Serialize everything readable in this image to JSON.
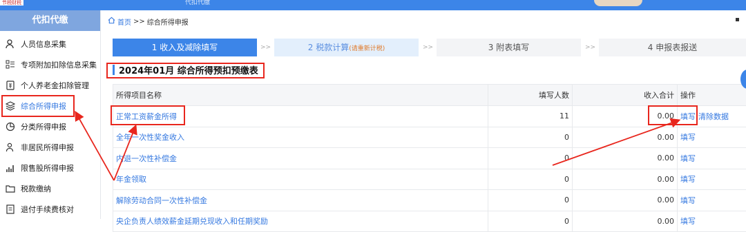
{
  "topbar": {
    "logo_text": "节税财税",
    "title": "代扣代缴"
  },
  "sidebar": {
    "header": "代扣代缴",
    "items": [
      {
        "label": "人员信息采集",
        "icon": "person-icon"
      },
      {
        "label": "专项附加扣除信息采集",
        "icon": "list-icon"
      },
      {
        "label": "个人养老金扣除管理",
        "icon": "pension-icon"
      },
      {
        "label": "综合所得申报",
        "icon": "layers-icon",
        "active": true
      },
      {
        "label": "分类所得申报",
        "icon": "pie-icon"
      },
      {
        "label": "非居民所得申报",
        "icon": "user-icon"
      },
      {
        "label": "限售股所得申报",
        "icon": "bar-chart-icon"
      },
      {
        "label": "税款缴纳",
        "icon": "folder-icon"
      },
      {
        "label": "退付手续费核对",
        "icon": "document-icon"
      }
    ]
  },
  "breadcrumb": {
    "home": "首页",
    "separator": ">>",
    "current": "综合所得申报"
  },
  "steps": [
    {
      "label": "1 收入及减除填写",
      "state": "active"
    },
    {
      "label": "2 税款计算",
      "note": "(请重新计税)",
      "state": "light"
    },
    {
      "label": "3 附表填写",
      "state": "normal"
    },
    {
      "label": "4 申报表报送",
      "state": "normal"
    }
  ],
  "step_arrow": ">>",
  "page_title": "2024年01月 综合所得预扣预缴表",
  "table": {
    "headers": [
      "所得项目名称",
      "填写人数",
      "收入合计",
      "操作"
    ],
    "rows": [
      {
        "name": "正常工资薪金所得",
        "count": "11",
        "income": "0.00",
        "op": "填写",
        "op2": "清除数据"
      },
      {
        "name": "全年一次性奖金收入",
        "count": "0",
        "income": "0.00",
        "op": "填写"
      },
      {
        "name": "内退一次性补偿金",
        "count": "0",
        "income": "0.00",
        "op": "填写"
      },
      {
        "name": "年金领取",
        "count": "0",
        "income": "0.00",
        "op": "填写"
      },
      {
        "name": "解除劳动合同一次性补偿金",
        "count": "0",
        "income": "0.00",
        "op": "填写"
      },
      {
        "name": "央企负责人绩效薪金延期兑现收入和任期奖励",
        "count": "0",
        "income": "0.00",
        "op": "填写"
      }
    ]
  },
  "colors": {
    "accent": "#3c85e8",
    "link": "#3478e0",
    "highlight": "#e8261d"
  }
}
